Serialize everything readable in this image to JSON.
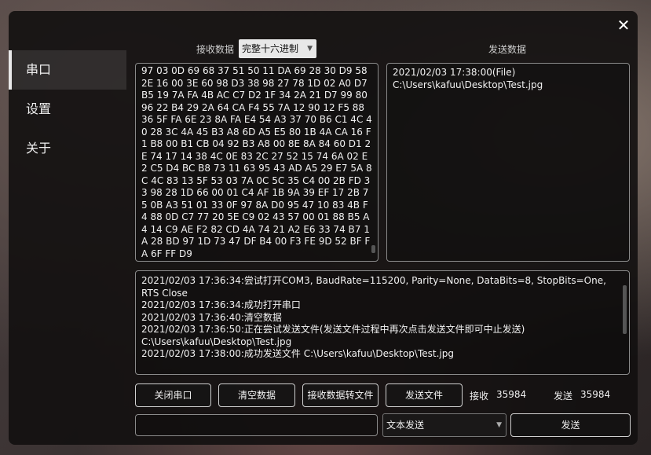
{
  "window": {
    "close_glyph": "✕"
  },
  "sidebar": {
    "items": [
      {
        "label": "串口",
        "active": true
      },
      {
        "label": "设置"
      },
      {
        "label": "关于"
      }
    ]
  },
  "receive": {
    "label": "接收数据",
    "mode_selected": "完整十六进制",
    "content": "97 03 0D 69 68 37 51 50 11 DA 69 28 30 D9 58 2E 16 00 3E 60 98 D3 38 98 27 78 1D 02 A0 D7 B5 19 7A FA 4B AC C7 D2 1F 34 2A 21 D7 99 80 96 22 B4 29 2A 64 CA F4 55 7A 12 90 12 F5 88 36 5F FA 6E 23 8A FA E4 54 A3 37 70 B6 C1 4C 40 28 3C 4A 45 B3 A8 6D A5 E5 80 1B 4A CA 16 F1 B8 00 B1 CB 04 92 B3 A8 00 8E 8A 84 60 D1 2E 74 17 14 38 4C 0E 83 2C 27 52 15 74 6A 02 E2 C5 D4 BC B8 73 11 63 95 43 AD A5 29 E7 5A 8C 4C 83 13 5F 53 03 7A 0C 5C 35 C4 00 2B FD 33 98 28 1D 66 00 01 C4 AF 1B 9A 39 EF 17 2B 75 0B A3 51 01 33 0F 97 8A D0 95 47 10 83 4B F4 88 0D C7 77 20 5E C9 02 43 57 00 01 88 B5 A4 14 C9 AE F2 82 CD 4A 74 21 A2 E6 33 74 B7 1A 28 BD 97 1D 73 47 DF B4 00 F3 FE 9D 52 BF FA 6F FF D9"
  },
  "send": {
    "label": "发送数据",
    "content_line1": "2021/02/03 17:38:00(File)",
    "content_line2": "C:\\Users\\kafuu\\Desktop\\Test.jpg"
  },
  "log": {
    "lines": [
      "2021/02/03 17:36:34:尝试打开COM3, BaudRate=115200, Parity=None, DataBits=8, StopBits=One, RTS Close",
      "2021/02/03 17:36:34:成功打开串口",
      "2021/02/03 17:36:40:清空数据",
      "2021/02/03 17:36:50:正在尝试发送文件(发送文件过程中再次点击发送文件即可中止发送) C:\\Users\\kafuu\\Desktop\\Test.jpg",
      "2021/02/03 17:38:00:成功发送文件 C:\\Users\\kafuu\\Desktop\\Test.jpg"
    ]
  },
  "buttons": {
    "close_port": "关闭串口",
    "clear_data": "清空数据",
    "recv_to_file": "接收数据转文件",
    "send_file": "发送文件",
    "send": "发送"
  },
  "stats": {
    "recv_label": "接收",
    "recv_value": "35984",
    "send_label": "发送",
    "send_value": "35984"
  },
  "send_input": {
    "value": "",
    "placeholder": ""
  },
  "send_mode": {
    "selected": "文本发送"
  },
  "icons": {
    "dropdown": "chevron-down-icon",
    "close": "close-icon"
  }
}
